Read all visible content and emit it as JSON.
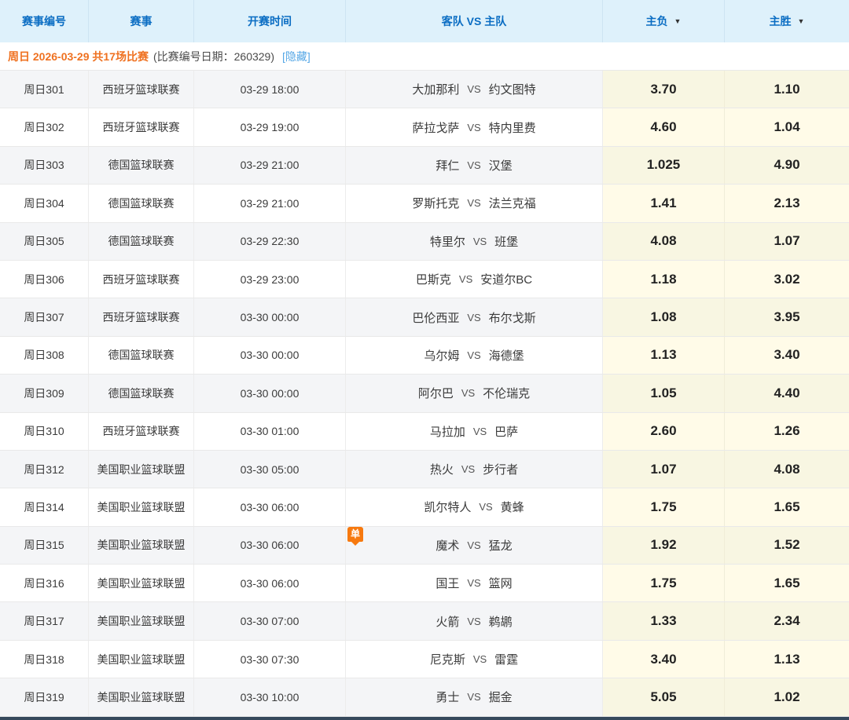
{
  "table": {
    "columns": [
      {
        "key": "match_no",
        "label": "赛事编号",
        "sortable": false
      },
      {
        "key": "league",
        "label": "赛事",
        "sortable": false
      },
      {
        "key": "start_time",
        "label": "开赛时间",
        "sortable": false
      },
      {
        "key": "teams",
        "label": "客队 VS 主队",
        "sortable": false
      },
      {
        "key": "home_lose",
        "label": "主负",
        "sortable": true
      },
      {
        "key": "home_win",
        "label": "主胜",
        "sortable": true
      }
    ],
    "vs_label": "VS",
    "group_header": {
      "date_text": "周日 2026-03-29 共17场比赛",
      "note_text": "(比赛编号日期：260329)",
      "hide_link_label": "[隐藏]"
    },
    "rows": [
      {
        "match_no": "周日301",
        "league": "西班牙篮球联赛",
        "start_time": "03-29 18:00",
        "away": "大加那利",
        "home": "约文图特",
        "home_lose": "3.70",
        "home_win": "1.10",
        "badge": ""
      },
      {
        "match_no": "周日302",
        "league": "西班牙篮球联赛",
        "start_time": "03-29 19:00",
        "away": "萨拉戈萨",
        "home": "特内里费",
        "home_lose": "4.60",
        "home_win": "1.04",
        "badge": ""
      },
      {
        "match_no": "周日303",
        "league": "德国篮球联赛",
        "start_time": "03-29 21:00",
        "away": "拜仁",
        "home": "汉堡",
        "home_lose": "1.025",
        "home_win": "4.90",
        "badge": ""
      },
      {
        "match_no": "周日304",
        "league": "德国篮球联赛",
        "start_time": "03-29 21:00",
        "away": "罗斯托克",
        "home": "法兰克福",
        "home_lose": "1.41",
        "home_win": "2.13",
        "badge": ""
      },
      {
        "match_no": "周日305",
        "league": "德国篮球联赛",
        "start_time": "03-29 22:30",
        "away": "特里尔",
        "home": "班堡",
        "home_lose": "4.08",
        "home_win": "1.07",
        "badge": ""
      },
      {
        "match_no": "周日306",
        "league": "西班牙篮球联赛",
        "start_time": "03-29 23:00",
        "away": "巴斯克",
        "home": "安道尔BC",
        "home_lose": "1.18",
        "home_win": "3.02",
        "badge": ""
      },
      {
        "match_no": "周日307",
        "league": "西班牙篮球联赛",
        "start_time": "03-30 00:00",
        "away": "巴伦西亚",
        "home": "布尔戈斯",
        "home_lose": "1.08",
        "home_win": "3.95",
        "badge": ""
      },
      {
        "match_no": "周日308",
        "league": "德国篮球联赛",
        "start_time": "03-30 00:00",
        "away": "乌尔姆",
        "home": "海德堡",
        "home_lose": "1.13",
        "home_win": "3.40",
        "badge": ""
      },
      {
        "match_no": "周日309",
        "league": "德国篮球联赛",
        "start_time": "03-30 00:00",
        "away": "阿尔巴",
        "home": "不伦瑞克",
        "home_lose": "1.05",
        "home_win": "4.40",
        "badge": ""
      },
      {
        "match_no": "周日310",
        "league": "西班牙篮球联赛",
        "start_time": "03-30 01:00",
        "away": "马拉加",
        "home": "巴萨",
        "home_lose": "2.60",
        "home_win": "1.26",
        "badge": ""
      },
      {
        "match_no": "周日312",
        "league": "美国职业篮球联盟",
        "start_time": "03-30 05:00",
        "away": "热火",
        "home": "步行者",
        "home_lose": "1.07",
        "home_win": "4.08",
        "badge": ""
      },
      {
        "match_no": "周日314",
        "league": "美国职业篮球联盟",
        "start_time": "03-30 06:00",
        "away": "凯尔特人",
        "home": "黄蜂",
        "home_lose": "1.75",
        "home_win": "1.65",
        "badge": ""
      },
      {
        "match_no": "周日315",
        "league": "美国职业篮球联盟",
        "start_time": "03-30 06:00",
        "away": "魔术",
        "home": "猛龙",
        "home_lose": "1.92",
        "home_win": "1.52",
        "badge": "单"
      },
      {
        "match_no": "周日316",
        "league": "美国职业篮球联盟",
        "start_time": "03-30 06:00",
        "away": "国王",
        "home": "篮网",
        "home_lose": "1.75",
        "home_win": "1.65",
        "badge": ""
      },
      {
        "match_no": "周日317",
        "league": "美国职业篮球联盟",
        "start_time": "03-30 07:00",
        "away": "火箭",
        "home": "鹈鹕",
        "home_lose": "1.33",
        "home_win": "2.34",
        "badge": ""
      },
      {
        "match_no": "周日318",
        "league": "美国职业篮球联盟",
        "start_time": "03-30 07:30",
        "away": "尼克斯",
        "home": "雷霆",
        "home_lose": "3.40",
        "home_win": "1.13",
        "badge": ""
      },
      {
        "match_no": "周日319",
        "league": "美国职业篮球联盟",
        "start_time": "03-30 10:00",
        "away": "勇士",
        "home": "掘金",
        "home_lose": "5.05",
        "home_win": "1.02",
        "badge": ""
      }
    ]
  },
  "icons": {
    "sort_arrow": "▼"
  },
  "colors": {
    "header_bg": "#def1fb",
    "header_text": "#0a6dc3",
    "date_orange": "#ef7120",
    "hide_link_blue": "#55a7e6",
    "row_stripe": "#f4f5f7",
    "odds_bg": "#fffbe8",
    "odds_bg_stripe": "#f8f6e2",
    "badge_orange": "#f7790f",
    "bottom_bar": "#36495c"
  }
}
